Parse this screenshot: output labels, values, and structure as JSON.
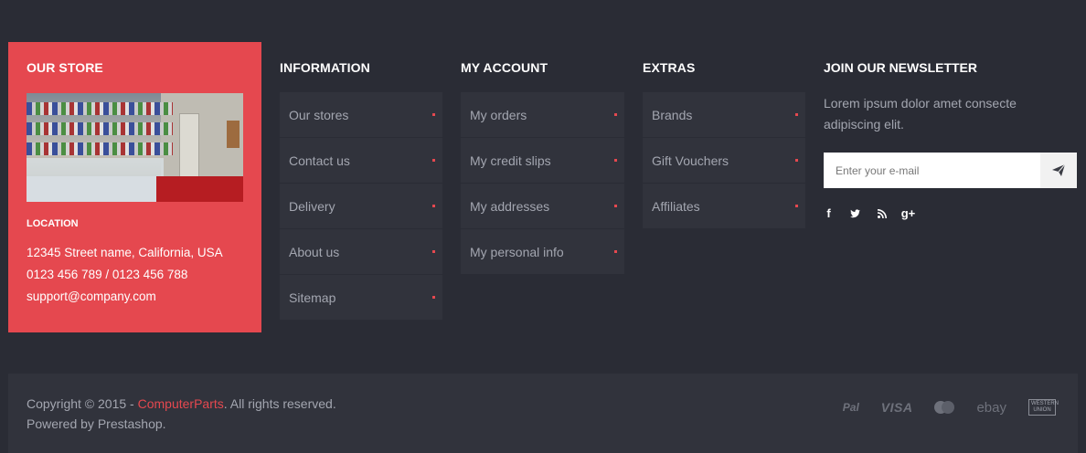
{
  "store": {
    "title": "OUR STORE",
    "location_title": "LOCATION",
    "address": "12345 Street name, California, USA",
    "phones": "0123 456 789 / 0123 456 788",
    "email": "support@company.com"
  },
  "information": {
    "title": "INFORMATION",
    "items": [
      "Our stores",
      "Contact us",
      "Delivery",
      "About us",
      "Sitemap"
    ]
  },
  "account": {
    "title": "MY ACCOUNT",
    "items": [
      "My orders",
      "My credit slips",
      "My addresses",
      "My personal info"
    ]
  },
  "extras": {
    "title": "EXTRAS",
    "items": [
      "Brands",
      "Gift Vouchers",
      "Affiliates"
    ]
  },
  "newsletter": {
    "title": "JOIN OUR NEWSLETTER",
    "description": "Lorem ipsum dolor amet consecte adipiscing elit.",
    "placeholder": "Enter your e-mail",
    "social": [
      "f",
      "t",
      "rss",
      "g+"
    ]
  },
  "footer": {
    "copyright_prefix": "Copyright © 2015 - ",
    "brand": "ComputerParts",
    "copyright_suffix": ". All rights reserved.",
    "powered": "Powered by Prestashop.",
    "payments": {
      "pal": "Pal",
      "visa": "VISA",
      "mastercard": "mastercard-icon",
      "ebay": "ebay",
      "western_union": "WESTERN UNION"
    }
  },
  "colors": {
    "accent": "#e5484f",
    "background": "#2a2c35",
    "panel": "#31333c"
  }
}
